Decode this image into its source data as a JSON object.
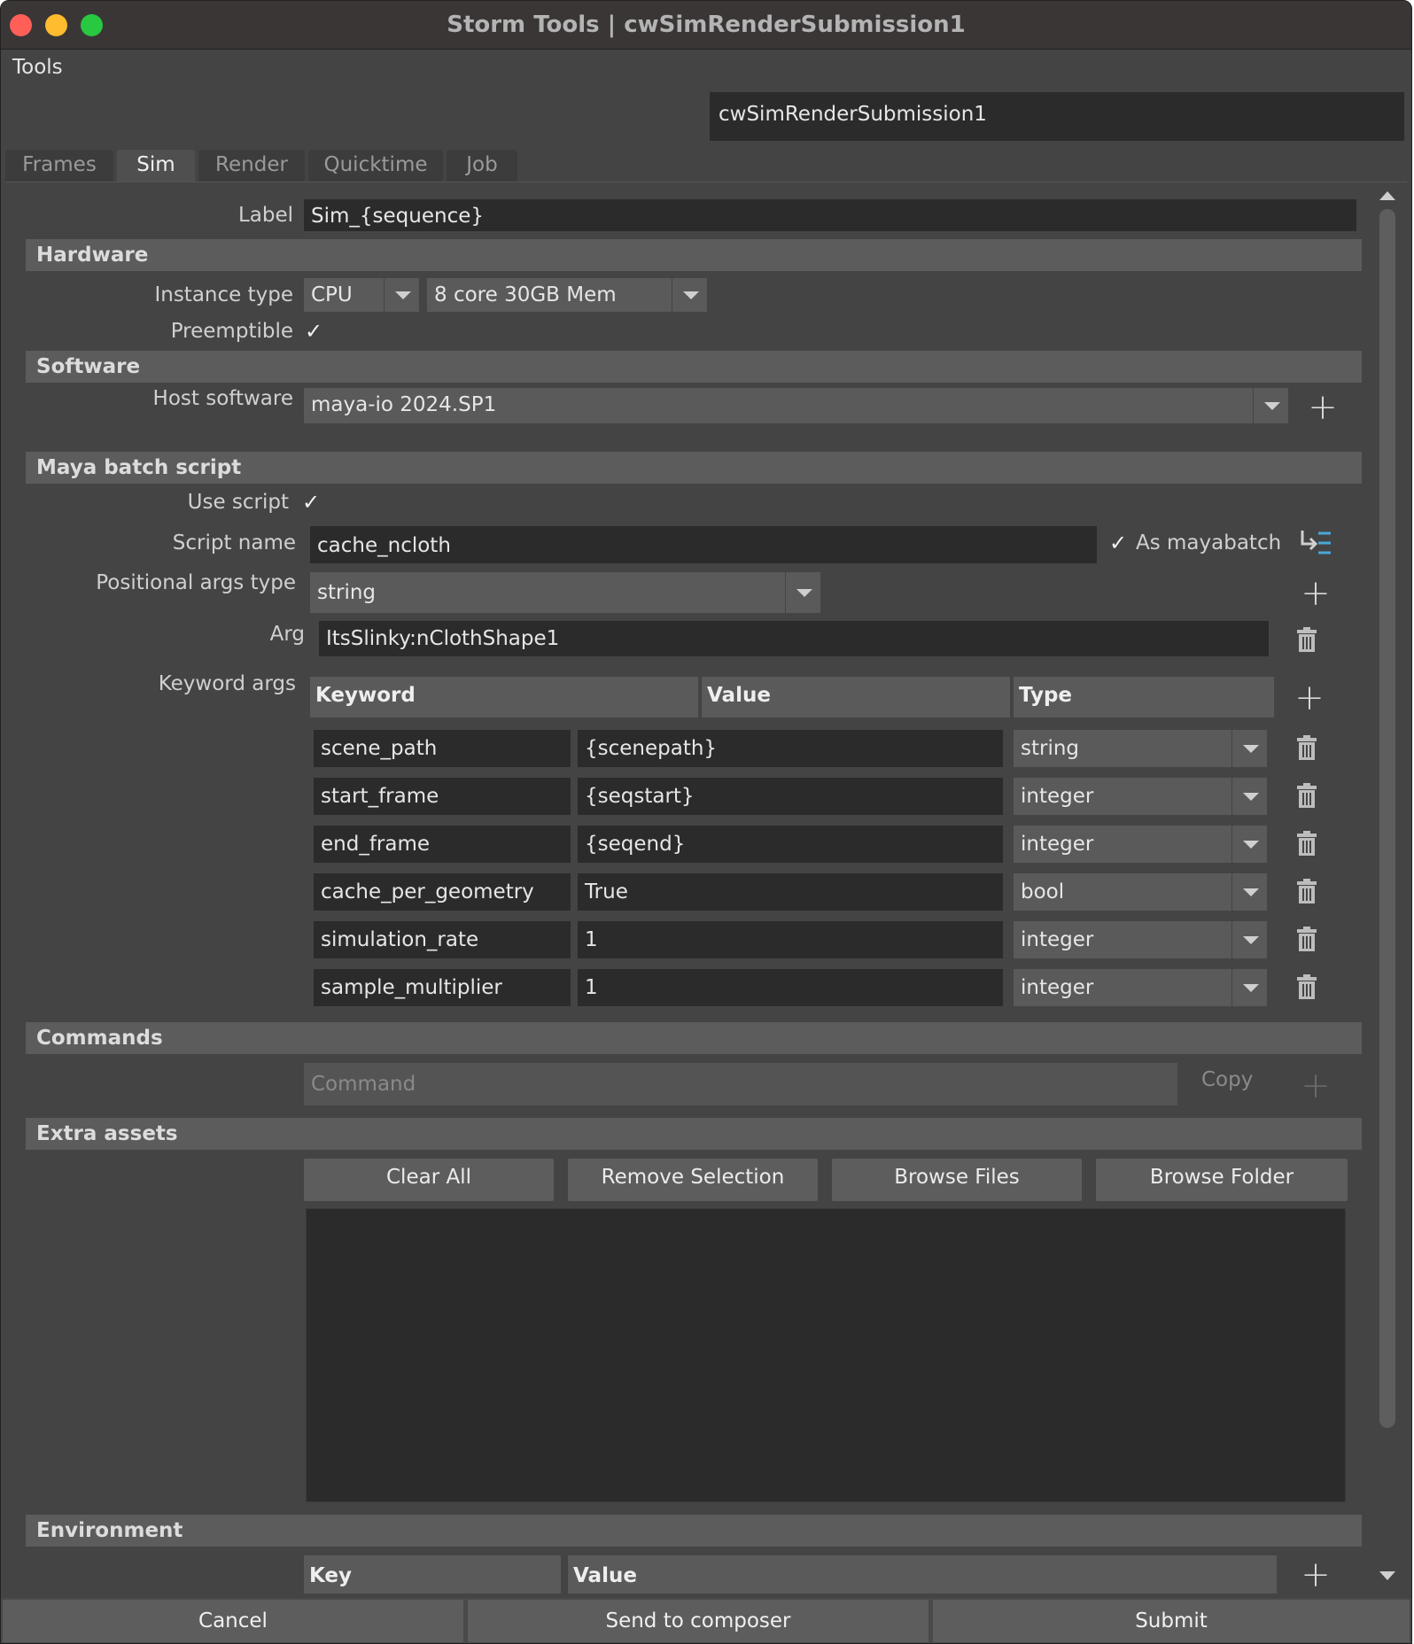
{
  "window": {
    "title": "Storm Tools | cwSimRenderSubmission1"
  },
  "menu": {
    "tools": "Tools"
  },
  "node_name": "cwSimRenderSubmission1",
  "tabs": [
    {
      "label": "Frames"
    },
    {
      "label": "Sim"
    },
    {
      "label": "Render"
    },
    {
      "label": "Quicktime"
    },
    {
      "label": "Job"
    }
  ],
  "active_tab": "Sim",
  "label_field": {
    "label": "Label",
    "value": "Sim_{sequence}"
  },
  "hardware": {
    "section": "Hardware",
    "instance_type_label": "Instance type",
    "instance_type": "CPU",
    "machine": "8 core 30GB Mem",
    "preemptible_label": "Preemptible",
    "preemptible_checked": true
  },
  "software": {
    "section": "Software",
    "host_label": "Host software",
    "host_value": "maya-io 2024.SP1"
  },
  "maya_batch": {
    "section": "Maya batch script",
    "use_script_label": "Use script",
    "use_script_checked": true,
    "script_name_label": "Script name",
    "script_name": "cache_ncloth",
    "as_mayabatch_label": "As mayabatch",
    "as_mayabatch_checked": true,
    "positional_label": "Positional args type",
    "positional_value": "string",
    "arg_label": "Arg",
    "arg_value": "ItsSlinky:nClothShape1",
    "keyword_label": "Keyword args",
    "headers": {
      "keyword": "Keyword",
      "value": "Value",
      "type": "Type"
    },
    "rows": [
      {
        "keyword": "scene_path",
        "value": "{scenepath}",
        "type": "string"
      },
      {
        "keyword": "start_frame",
        "value": "{seqstart}",
        "type": "integer"
      },
      {
        "keyword": "end_frame",
        "value": "{seqend}",
        "type": "integer"
      },
      {
        "keyword": "cache_per_geometry",
        "value": "True",
        "type": "bool"
      },
      {
        "keyword": "simulation_rate",
        "value": "1",
        "type": "integer"
      },
      {
        "keyword": "sample_multiplier",
        "value": "1",
        "type": "integer"
      }
    ]
  },
  "commands": {
    "section": "Commands",
    "placeholder": "Command",
    "copy_label": "Copy"
  },
  "extra_assets": {
    "section": "Extra assets",
    "clear_all": "Clear All",
    "remove_selection": "Remove Selection",
    "browse_files": "Browse Files",
    "browse_folder": "Browse Folder"
  },
  "environment": {
    "section": "Environment",
    "key_header": "Key",
    "value_header": "Value"
  },
  "footer": {
    "cancel": "Cancel",
    "send_to_composer": "Send to composer",
    "submit": "Submit"
  }
}
